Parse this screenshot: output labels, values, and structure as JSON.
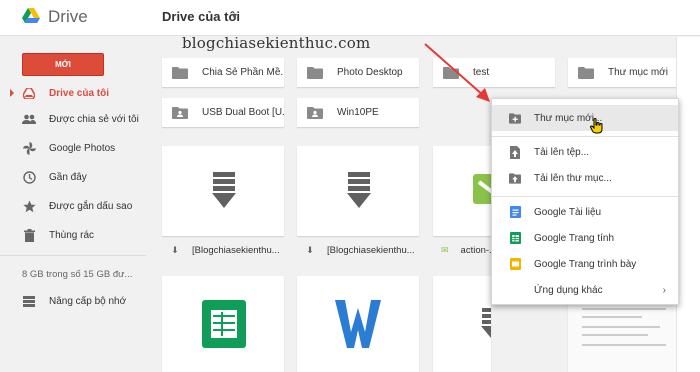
{
  "header": {
    "app_title": "Drive",
    "breadcrumb": "Drive của tôi",
    "watermark": "blogchiasekienthuc.com"
  },
  "sidebar": {
    "new_button": "MỚI",
    "items": [
      {
        "label": "Drive của tôi",
        "icon": "drive-icon"
      },
      {
        "label": "Được chia sẻ với tôi",
        "icon": "people-icon"
      },
      {
        "label": "Google Photos",
        "icon": "pinwheel-icon"
      },
      {
        "label": "Gần đây",
        "icon": "clock-icon"
      },
      {
        "label": "Được gắn dấu sao",
        "icon": "star-icon"
      },
      {
        "label": "Thùng rác",
        "icon": "trash-icon"
      }
    ],
    "storage_text": "8 GB trong số 15 GB đư...",
    "upgrade_label": "Nâng cấp bộ nhớ"
  },
  "folders": [
    {
      "name": "Chia Sẻ Phần Mề...",
      "shared": false
    },
    {
      "name": "Photo Desktop",
      "shared": false
    },
    {
      "name": "test",
      "shared": false
    },
    {
      "name": "Thư mục mới",
      "shared": false
    },
    {
      "name": "USB Dual Boot [U...",
      "shared": true
    },
    {
      "name": "Win10PE",
      "shared": true
    }
  ],
  "files": [
    {
      "name": "[Blogchiasekienthu...",
      "type": "download"
    },
    {
      "name": "[Blogchiasekienthu...",
      "type": "download"
    },
    {
      "name": "action-...",
      "type": "image"
    }
  ],
  "menu": {
    "new_folder": "Thư mục mới...",
    "upload_files": "Tải lên tệp...",
    "upload_folder": "Tải lên thư mục...",
    "google_docs": "Google Tài liệu",
    "google_sheets": "Google Trang tính",
    "google_slides": "Google Trang trình bày",
    "more_apps": "Ứng dụng khác"
  },
  "colors": {
    "accent_red": "#dd4b39",
    "docs_blue": "#4285f4",
    "sheets_green": "#0f9d58",
    "slides_yellow": "#f4b400"
  }
}
